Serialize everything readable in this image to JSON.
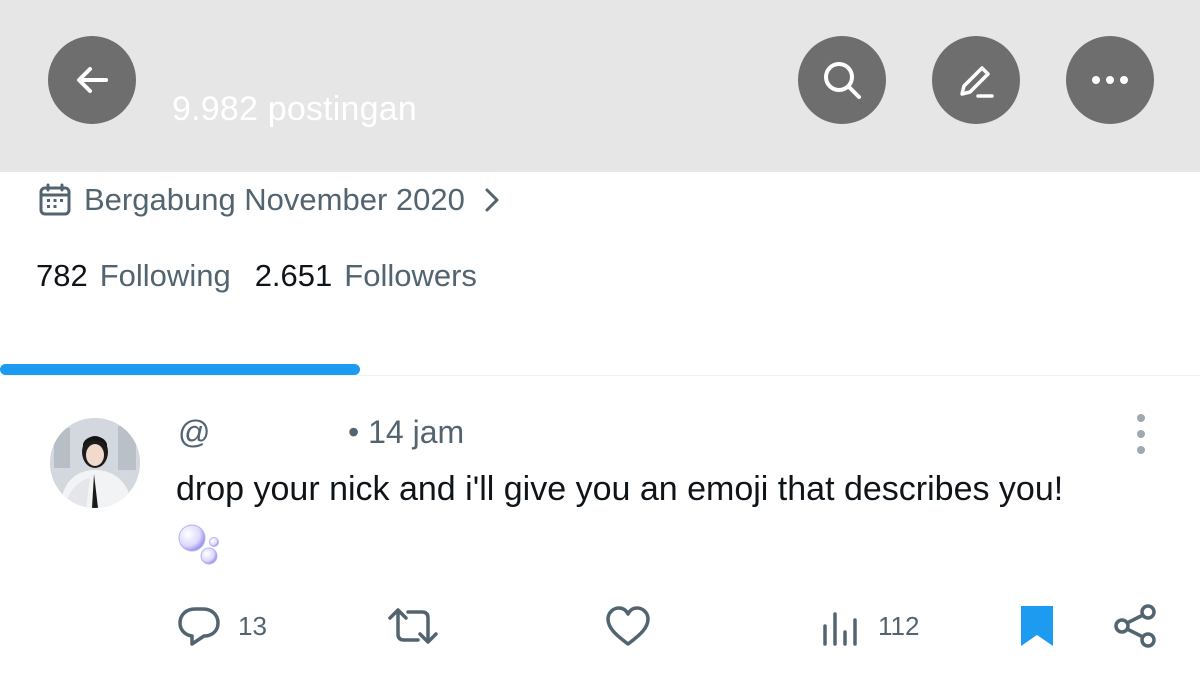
{
  "header": {
    "post_count": "9.982 postingan",
    "back_icon": "arrow-left-icon",
    "search_icon": "search-icon",
    "edit_icon": "pencil-icon",
    "more_icon": "more-horizontal-icon",
    "button_color": "#6e6e6e",
    "background": "#e6e6e6"
  },
  "profile": {
    "joined": "Bergabung November 2020",
    "following_count": "782",
    "following_label": "Following",
    "followers_count": "2.651",
    "followers_label": "Followers"
  },
  "tabs": {
    "active_indicator_color": "#1d9bf0"
  },
  "tweet": {
    "handle": "@",
    "time": "• 14 jam",
    "text": "drop your nick and i'll give you an emoji that describes you!",
    "emoji": "bubbles-emoji",
    "actions": {
      "reply_count": "13",
      "retweet_count": "",
      "like_count": "",
      "views_count": "112",
      "bookmarked": true
    }
  },
  "colors": {
    "accent": "#1d9bf0",
    "secondary_text": "#536471",
    "primary_text": "#0f1419"
  }
}
